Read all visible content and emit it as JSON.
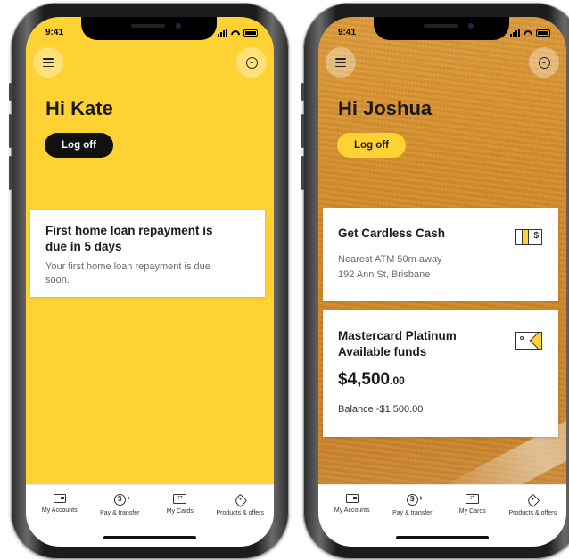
{
  "left": {
    "status_time": "9:41",
    "greeting": "Hi Kate",
    "logoff_label": "Log off",
    "notice": {
      "title": "First home loan repayment is due in 5 days",
      "body": "Your first home loan repayment is due soon."
    },
    "tabs": [
      {
        "label": "My Accounts",
        "icon": "wallet-icon"
      },
      {
        "label": "Pay & transfer",
        "icon": "pay-transfer-icon"
      },
      {
        "label": "My Cards",
        "icon": "card-icon"
      },
      {
        "label": "Products & offers",
        "icon": "tag-icon"
      }
    ]
  },
  "right": {
    "status_time": "9:41",
    "greeting": "Hi Joshua",
    "logoff_label": "Log off",
    "cardless": {
      "title": "Get Cardless Cash",
      "line1": "Nearest ATM 50m away",
      "line2": "192 Ann St, Brisbane"
    },
    "mastercard": {
      "title_line1": "Mastercard Platinum",
      "title_line2": "Available funds",
      "amount_main": "$4,500",
      "amount_cents": ".00",
      "balance": "Balance -$1,500.00"
    },
    "tabs": [
      {
        "label": "My Accounts",
        "icon": "wallet-icon"
      },
      {
        "label": "Pay & transfer",
        "icon": "pay-transfer-icon"
      },
      {
        "label": "My Cards",
        "icon": "card-icon"
      },
      {
        "label": "Products & offers",
        "icon": "tag-icon"
      }
    ]
  },
  "colors": {
    "brand_yellow": "#ffd233",
    "dark": "#111111",
    "wood": "#d9912c"
  },
  "icons": {
    "menu": "hamburger-menu-icon",
    "assistant": "chat-assistant-icon",
    "cardless_cash": "cardless-cash-icon",
    "mastercard": "credit-card-icon"
  }
}
